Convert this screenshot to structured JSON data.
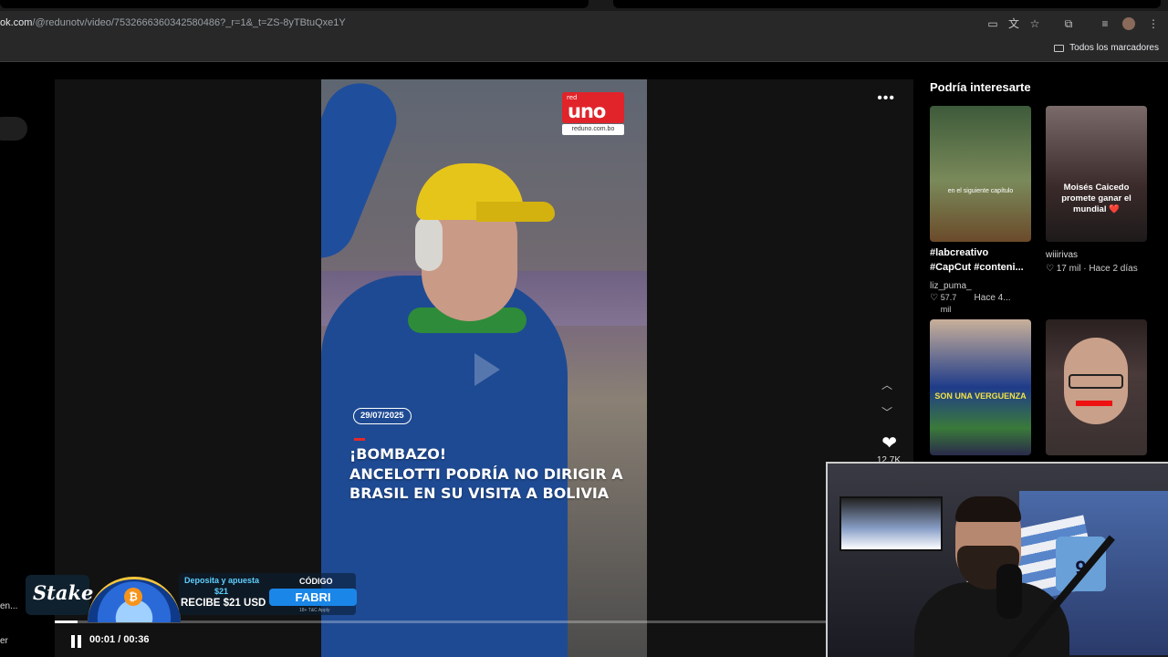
{
  "browser": {
    "url_domain": "ok.com",
    "url_rest": "/@redunotv/video/7532666360342580486?_r=1&_t=ZS-8yTBtuQxe1Y",
    "bookmarks_label": "Todos los marcadores"
  },
  "player": {
    "logo_small": "red",
    "logo_big": "uno",
    "logo_url": "reduno.com.bo",
    "date": "29/07/2025",
    "headline": "¡BOMBAZO!\nANCELOTTI PODRÍA NO DIRIGIR A BRASIL EN SU VISITA A BOLIVIA",
    "more_icon": "•••",
    "heart_count": "12.7K",
    "time_current": "00:01",
    "time_total": "00:36",
    "progress": 0.027
  },
  "sidebar": {
    "title": "Podría interesarte",
    "items": [
      {
        "overlay": "en el siguiente capítulo",
        "title": "#labcreativo #CapCut #conteni...",
        "author": "liz_puma_",
        "likes": "57.7 mil",
        "age": "Hace 4..."
      },
      {
        "overlay": "Moisés Caicedo promete ganar el mundial ❤️",
        "title": "",
        "author": "wiiirivas",
        "likes": "17 mil",
        "age": "Hace 2 días"
      },
      {
        "overlay": "SON UNA VERGUENZA",
        "title": "",
        "author": "",
        "likes": "",
        "age": ""
      },
      {
        "overlay": "",
        "title": "",
        "author": "",
        "likes": "",
        "age": ""
      }
    ]
  },
  "left_fragments": [
    "en...",
    "er"
  ],
  "promo": {
    "brand": "Stake",
    "deposit_text": "Deposita y apuesta",
    "deposit_amount": "$21",
    "receive_text": "RECIBE $21 USD",
    "code_label": "CÓDIGO",
    "code_value": "FABRI",
    "tc": "18+ T&C Apply"
  },
  "webcam": {
    "jersey_number": "9"
  },
  "colors": {
    "accent_red": "#e0242a",
    "code_blue": "#1a86e8"
  }
}
